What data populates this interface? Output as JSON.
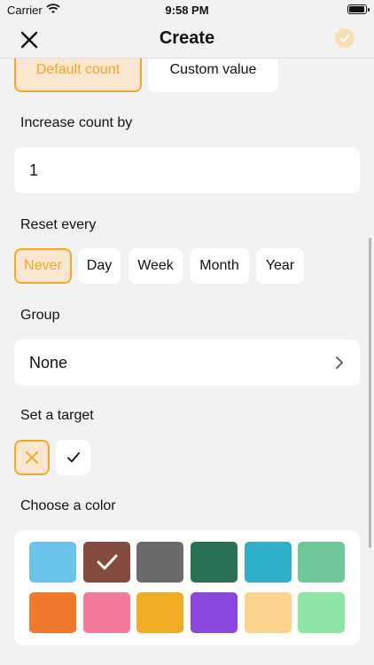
{
  "status_bar": {
    "carrier": "Carrier",
    "time": "9:58 PM"
  },
  "nav": {
    "title": "Create"
  },
  "count_mode": {
    "options": [
      "Default count",
      "Custom value"
    ],
    "selected": "Default count"
  },
  "increase": {
    "label": "Increase count by",
    "value": "1"
  },
  "reset": {
    "label": "Reset every",
    "options": [
      "Never",
      "Day",
      "Week",
      "Month",
      "Year"
    ],
    "selected": "Never"
  },
  "group": {
    "label": "Group",
    "value": "None"
  },
  "target": {
    "label": "Set a target",
    "selected": "off"
  },
  "color": {
    "label": "Choose a color",
    "swatches": [
      "#6ac4ea",
      "#844b3e",
      "#6b6b6b",
      "#2a7154",
      "#2fb0c9",
      "#6fc79a",
      "#f07a2c",
      "#f47a9c",
      "#efac24",
      "#8b46dd",
      "#fbd38a",
      "#8ee6a6"
    ],
    "selected_index": 1
  },
  "accent": "#f5a623"
}
